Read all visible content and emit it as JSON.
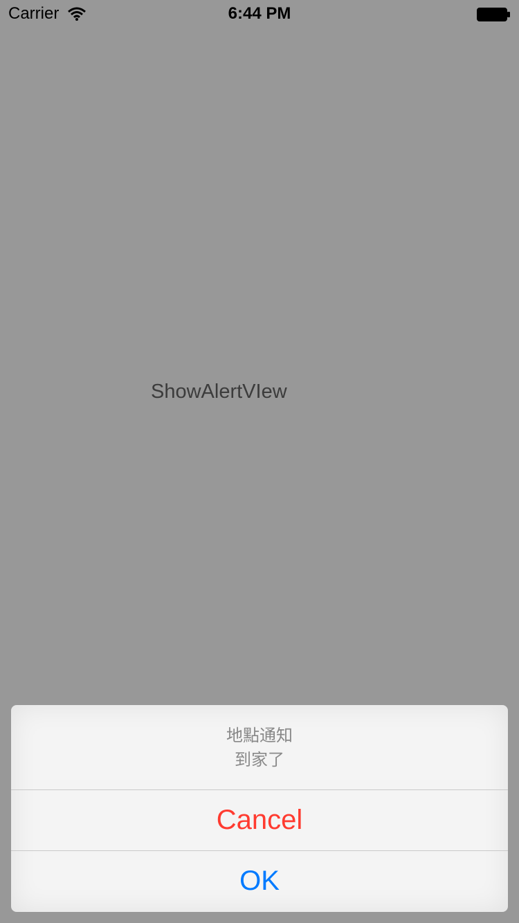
{
  "status_bar": {
    "carrier": "Carrier",
    "time": "6:44 PM",
    "wifi_icon": "wifi-icon",
    "battery_icon": "battery-icon"
  },
  "main": {
    "label": "ShowAlertVIew"
  },
  "action_sheet": {
    "title": "地點通知",
    "message": "到家了",
    "cancel_label": "Cancel",
    "ok_label": "OK",
    "cancel_color": "#ff3b30",
    "ok_color": "#007aff"
  }
}
